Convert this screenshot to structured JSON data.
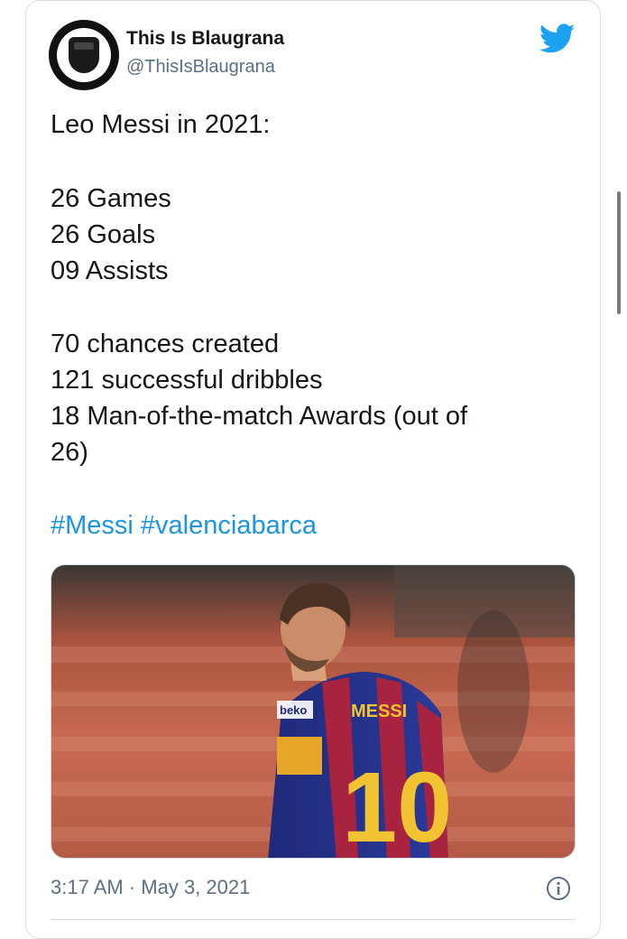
{
  "author": {
    "display_name": "This Is Blaugrana",
    "handle": "@ThisIsBlaugrana"
  },
  "tweet": {
    "lines": [
      "Leo Messi in 2021:",
      "26 Games",
      "26 Goals",
      "09 Assists",
      "70 chances created",
      "121 successful dribbles",
      "18 Man-of-the-match Awards (out of",
      "26)"
    ],
    "hashtags": "#Messi #valenciabarca"
  },
  "media": {
    "jersey_name": "MESSI",
    "jersey_number": "10",
    "sponsor": "beko"
  },
  "meta": {
    "timestamp": "3:17 AM · May 3, 2021"
  },
  "icons": {
    "brand": "twitter-bird-icon",
    "info": "info-icon"
  },
  "colors": {
    "brand_blue": "#1da1f2",
    "link_blue": "#1b95e0",
    "text": "#14171a",
    "secondary": "#5b7083"
  }
}
